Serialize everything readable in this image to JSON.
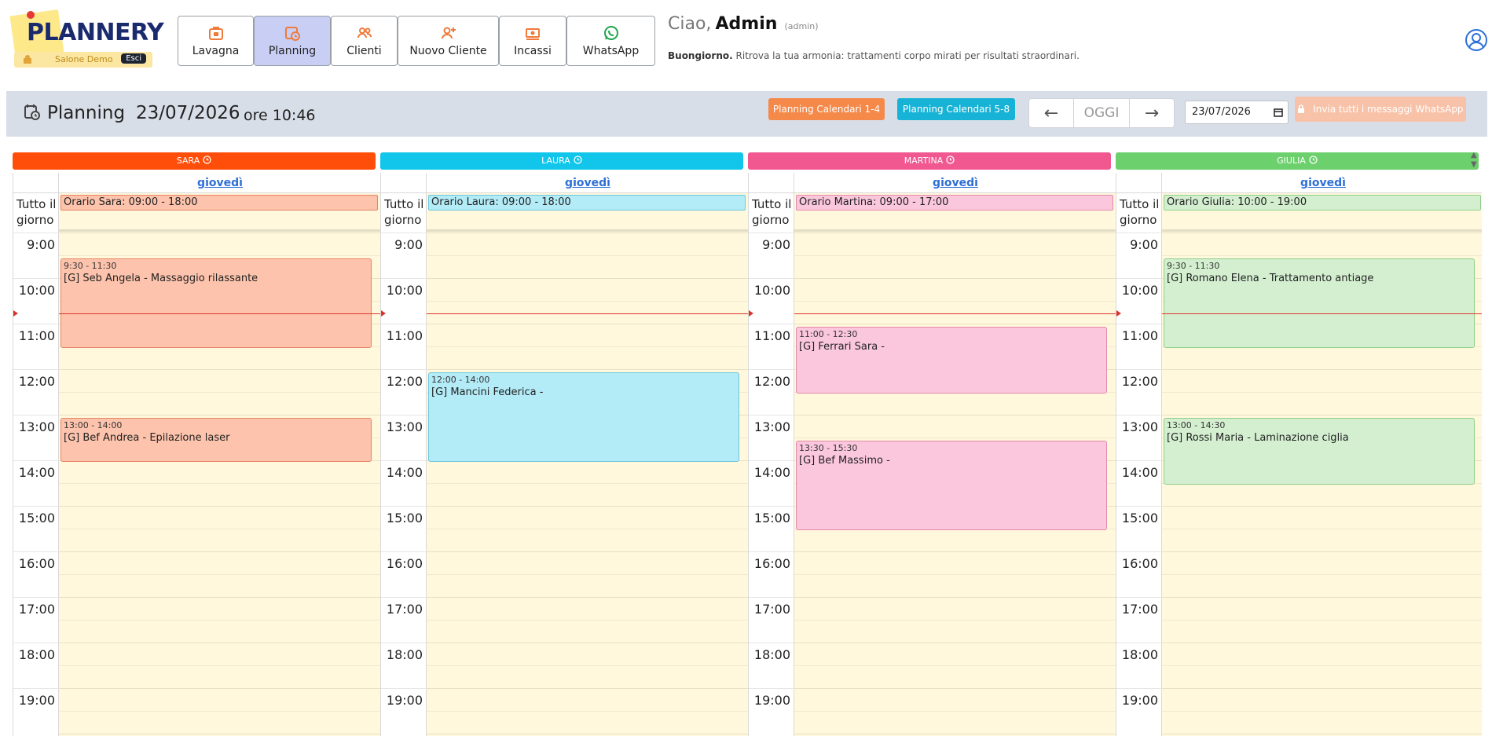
{
  "brand": {
    "logo_text": "PLANNERY",
    "salon_name": "Salone Demo",
    "logout_label": "Esci"
  },
  "nav": [
    {
      "label": "Lavagna",
      "icon": "board-icon",
      "active": false
    },
    {
      "label": "Planning",
      "icon": "calendar-clock-icon",
      "active": true
    },
    {
      "label": "Clienti",
      "icon": "users-icon",
      "active": false
    },
    {
      "label": "Nuovo Cliente",
      "icon": "user-add-icon",
      "active": false
    },
    {
      "label": "Incassi",
      "icon": "money-icon",
      "active": false
    },
    {
      "label": "WhatsApp",
      "icon": "whatsapp-icon",
      "active": false
    }
  ],
  "greeting": {
    "hello": "Ciao,",
    "name": "Admin",
    "role": "(admin)"
  },
  "tagline": {
    "bold": "Buongiorno.",
    "text": "Ritrova la tua armonia: trattamenti corpo mirati per risultati straordinari."
  },
  "toolbar": {
    "title": "Planning",
    "date": "23/07/2026",
    "time": "ore 10:46",
    "btn_cal_1_4": "Planning Calendari 1-4",
    "btn_cal_5_8": "Planning Calendari 5-8",
    "today_label": "OGGI",
    "prev_label": "←",
    "next_label": "→",
    "date_input_value": "23/07/2026",
    "whatsapp_all_label": "Invia tutti i messaggi WhatsApp"
  },
  "colors": {
    "sara": "#ff4e0a",
    "sara_event": "#fdc3ac",
    "sara_border": "#e58466",
    "laura": "#11c6ea",
    "laura_event": "#b3ebf7",
    "laura_border": "#6cc7dd",
    "martina": "#f0588f",
    "martina_event": "#fbc7dd",
    "martina_border": "#e48aab",
    "giulia": "#6cd06c",
    "giulia_event": "#d3efd0",
    "giulia_border": "#8fcf8a"
  },
  "staff": [
    {
      "name": "SARA",
      "day": "giovedì",
      "allday_label": "Tutto il giorno",
      "hours_label": "Orario Sara: 09:00 - 18:00",
      "events": [
        {
          "time": "9:30 - 11:30",
          "title": "[G] Seb Angela - Massaggio rilassante",
          "start": 9.5,
          "end": 11.5
        },
        {
          "time": "13:00 - 14:00",
          "title": "[G] Bef Andrea - Epilazione laser",
          "start": 13,
          "end": 14
        }
      ]
    },
    {
      "name": "LAURA",
      "day": "giovedì",
      "allday_label": "Tutto il giorno",
      "hours_label": "Orario Laura: 09:00 - 18:00",
      "events": [
        {
          "time": "12:00 - 14:00",
          "title": "[G] Mancini Federica -",
          "start": 12,
          "end": 14
        }
      ]
    },
    {
      "name": "MARTINA",
      "day": "giovedì",
      "allday_label": "Tutto il giorno",
      "hours_label": "Orario Martina: 09:00 - 17:00",
      "events": [
        {
          "time": "11:00 - 12:30",
          "title": "[G] Ferrari Sara -",
          "start": 11,
          "end": 12.5
        },
        {
          "time": "13:30 - 15:30",
          "title": "[G] Bef Massimo -",
          "start": 13.5,
          "end": 15.5
        }
      ]
    },
    {
      "name": "GIULIA",
      "day": "giovedì",
      "allday_label": "Tutto il giorno",
      "hours_label": "Orario Giulia: 10:00 - 19:00",
      "events": [
        {
          "time": "9:30 - 11:30",
          "title": "[G] Romano Elena - Trattamento antiage",
          "start": 9.5,
          "end": 11.5
        },
        {
          "time": "13:00 - 14:30",
          "title": "[G] Rossi Maria - Laminazione ciglia",
          "start": 13,
          "end": 14.5
        }
      ]
    }
  ],
  "hours": [
    "9:00",
    "10:00",
    "11:00",
    "12:00",
    "13:00",
    "14:00",
    "15:00",
    "16:00",
    "17:00",
    "18:00",
    "19:00"
  ],
  "now_hour": 10.77
}
